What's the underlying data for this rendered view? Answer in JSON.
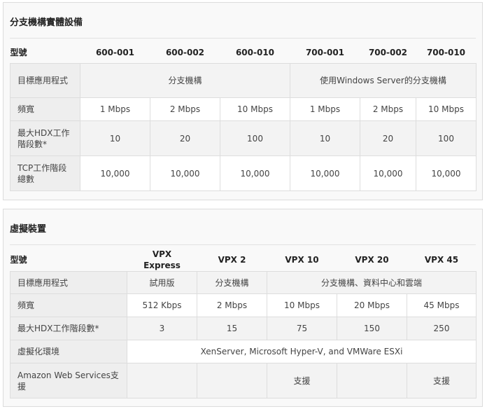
{
  "branch": {
    "title": "分支機構實體設備",
    "model_label": "型號",
    "models": [
      "600-001",
      "600-002",
      "600-010",
      "700-001",
      "700-002",
      "700-010"
    ],
    "rows": {
      "app_label": "目標應用程式",
      "app_a": "分支機構",
      "app_b": "使用Windows Server的分支機構",
      "bw_label": "頻寬",
      "bw": [
        "1 Mbps",
        "2 Mbps",
        "10 Mbps",
        "1 Mbps",
        "2 Mbps",
        "10  Mbps"
      ],
      "hdx_label": "最大HDX工作階段數*",
      "hdx": [
        "10",
        "20",
        "100",
        "10",
        "20",
        "100"
      ],
      "tcp_label": "TCP工作階段總數",
      "tcp": [
        "10,000",
        "10,000",
        "10,000",
        "10,000",
        "10,000",
        "10,000"
      ]
    }
  },
  "virtual": {
    "title": "虛擬裝置",
    "model_label": "型號",
    "models": [
      "VPX Express",
      "VPX 2",
      "VPX 10",
      "VPX 20",
      "VPX 45"
    ],
    "rows": {
      "app_label": "目標應用程式",
      "app_a": "試用版",
      "app_b": "分支機構",
      "app_c": "分支機構、資料中心和雲端",
      "bw_label": "頻寬",
      "bw": [
        "512 Kbps",
        "2 Mbps",
        "10 Mbps",
        "20 Mbps",
        "45 Mbps"
      ],
      "hdx_label": "最大HDX工作階段數*",
      "hdx": [
        "3",
        "15",
        "75",
        "150",
        "250"
      ],
      "virt_label": "虛擬化環境",
      "virt": "XenServer, Microsoft Hyper-V, and VMWare ESXi",
      "aws_label": "Amazon Web Services支援",
      "aws": [
        "",
        "",
        "支援",
        "",
        "支援"
      ]
    }
  }
}
